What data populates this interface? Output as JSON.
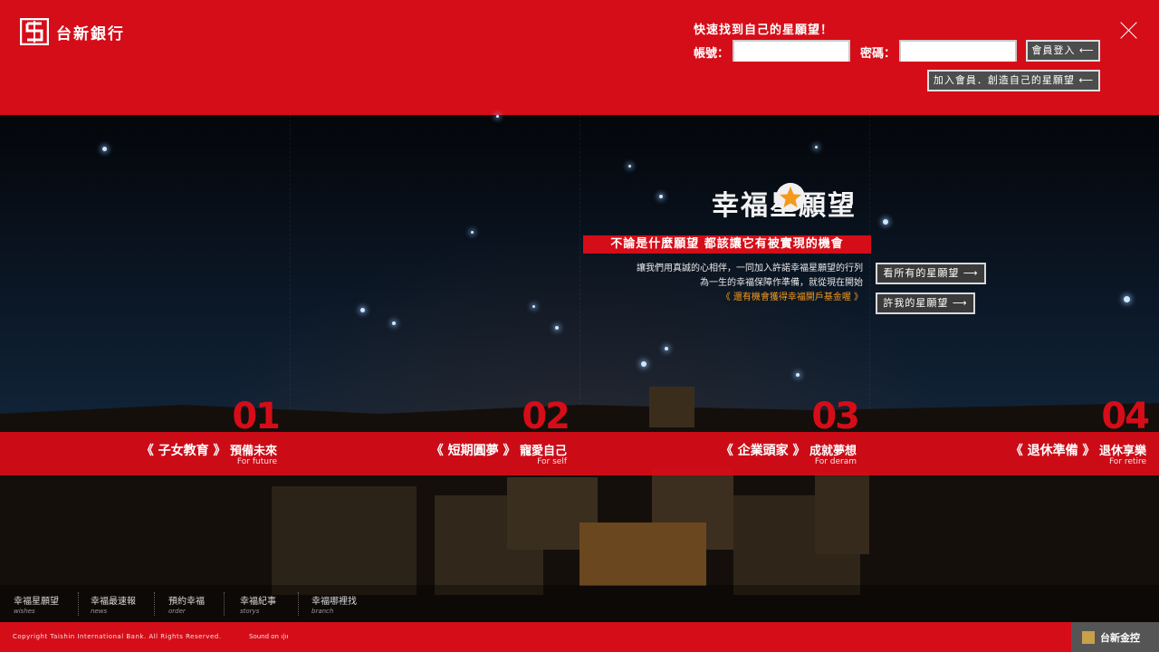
{
  "brand": {
    "name": "台新銀行"
  },
  "login": {
    "title": "快速找到自己的星願望！",
    "account_label": "帳號：",
    "password_label": "密碼：",
    "login_button": "會員登入 ⟵",
    "join_button": "加入會員．創造自己的星願望 ⟵"
  },
  "hero": {
    "headline": "幸福星願望",
    "tagline": "不論是什麼願望  都該讓它有被實現的機會",
    "desc_line1": "讓我們用真誠的心相伴，一同加入許諾幸福星願望的行列",
    "desc_line2": "為一生的幸福保障作準備，就從現在開始",
    "note": "《 還有機會獲得幸福開戶基金喔 》",
    "view_all_button": "看所有的星願望 ⟶",
    "make_wish_button": "許我的星願望 ⟶"
  },
  "categories": [
    {
      "num": "01",
      "title": "《 子女教育 》",
      "subtitle": "預備未來",
      "en": "For future"
    },
    {
      "num": "02",
      "title": "《 短期圓夢 》",
      "subtitle": "寵愛自己",
      "en": "For self"
    },
    {
      "num": "03",
      "title": "《 企業頭家 》",
      "subtitle": "成就夢想",
      "en": "For deram"
    },
    {
      "num": "04",
      "title": "《 退休準備 》",
      "subtitle": "退休享樂",
      "en": "For retire"
    }
  ],
  "nav": [
    {
      "zh": "幸福星願望",
      "en": "wishes"
    },
    {
      "zh": "幸福最速報",
      "en": "news"
    },
    {
      "zh": "預約幸福",
      "en": "order"
    },
    {
      "zh": "幸福紀事",
      "en": "storys"
    },
    {
      "zh": "幸福哪裡找",
      "en": "branch"
    }
  ],
  "footer": {
    "copyright": "Copyright Taishin International Bank. All Rights Reserved.",
    "sound": "Sound on ı|ıı",
    "holding": "台新金控"
  },
  "colors": {
    "brand_red": "#d50d18",
    "accent_orange": "#f59a1d"
  }
}
